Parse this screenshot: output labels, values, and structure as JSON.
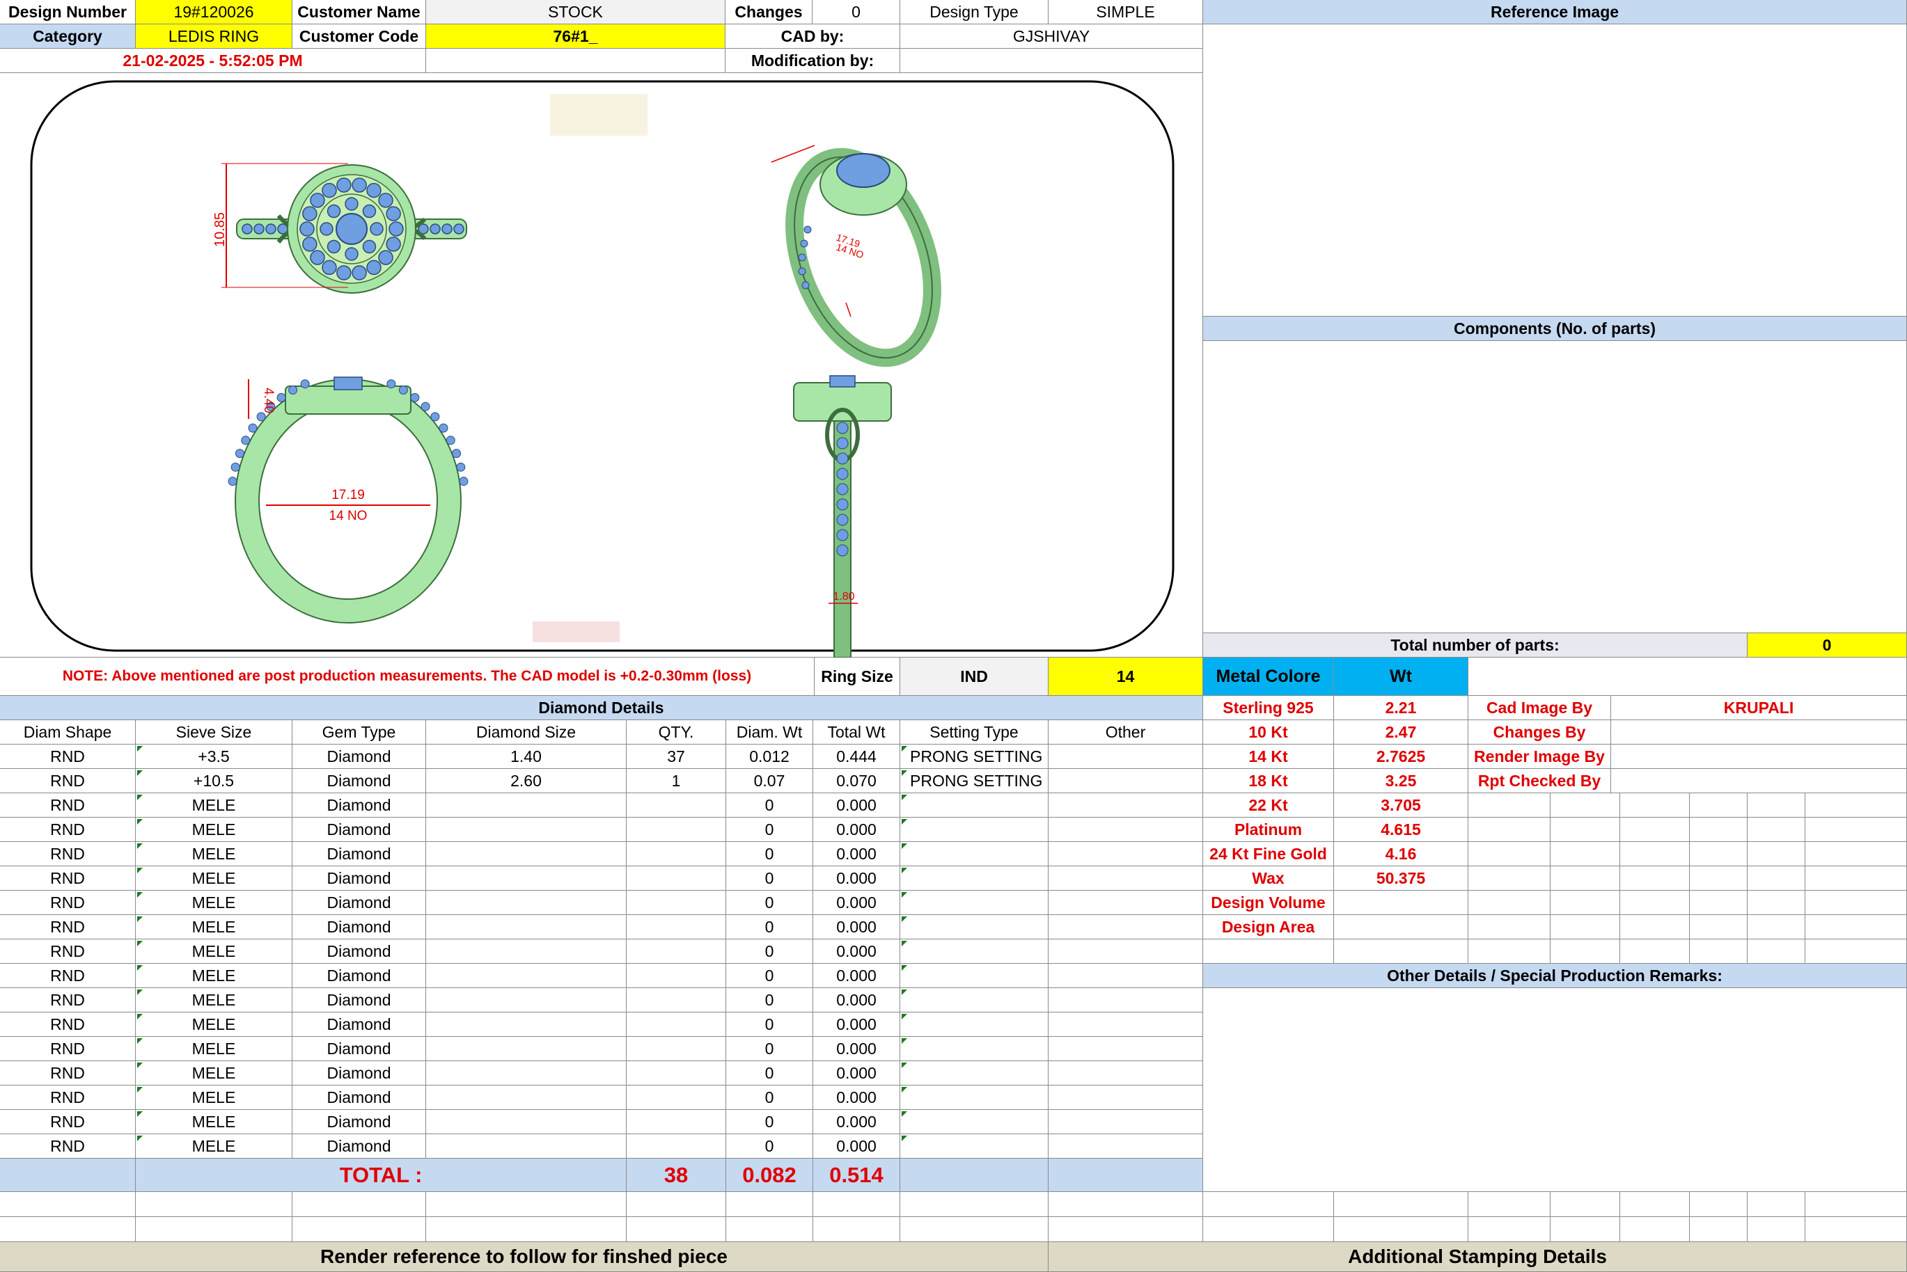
{
  "header": {
    "design_number_label": "Design Number",
    "design_number": "19#120026",
    "customer_name_label": "Customer Name",
    "customer_name": "STOCK",
    "changes_label": "Changes",
    "changes": "0",
    "design_type_label": "Design Type",
    "design_type": "SIMPLE",
    "reference_image_label": "Reference Image",
    "category_label": "Category",
    "category": "LEDIS RING",
    "customer_code_label": "Customer Code",
    "customer_code": "76#1_",
    "cad_by_label": "CAD by:",
    "cad_by": "GJSHIVAY",
    "datetime": "21-02-2025 - 5:52:05 PM",
    "modification_label": "Modification by:"
  },
  "cad": {
    "top_dim": "10.85",
    "side_dim1": "17.19",
    "side_dim2": "14 NO",
    "front_dim": "4.40",
    "inner_dim1": "17.19",
    "inner_dim2": "14 NO",
    "shank_dim": "1.80"
  },
  "components_label": "Components (No. of parts)",
  "total_parts_label": "Total number of parts:",
  "total_parts": "0",
  "note": "NOTE: Above mentioned are post production measurements. The CAD model is +0.2-0.30mm (loss)",
  "ring_size_label": "Ring Size",
  "ring_size_std": "IND",
  "ring_size": "14",
  "metal_colore_label": "Metal Colore",
  "wt_label": "Wt",
  "diamond_details_label": "Diamond Details",
  "diamond_headers": [
    "Diam Shape",
    "Sieve Size",
    "Gem Type",
    "Diamond Size",
    "QTY.",
    "Diam. Wt",
    "Total Wt",
    "Setting Type",
    "Other"
  ],
  "diamond_rows": [
    [
      "RND",
      "+3.5",
      "Diamond",
      "1.40",
      "37",
      "0.012",
      "0.444",
      "PRONG SETTING",
      ""
    ],
    [
      "RND",
      "+10.5",
      "Diamond",
      "2.60",
      "1",
      "0.07",
      "0.070",
      "PRONG SETTING",
      ""
    ],
    [
      "RND",
      "MELE",
      "Diamond",
      "",
      "",
      "0",
      "0.000",
      "",
      ""
    ],
    [
      "RND",
      "MELE",
      "Diamond",
      "",
      "",
      "0",
      "0.000",
      "",
      ""
    ],
    [
      "RND",
      "MELE",
      "Diamond",
      "",
      "",
      "0",
      "0.000",
      "",
      ""
    ],
    [
      "RND",
      "MELE",
      "Diamond",
      "",
      "",
      "0",
      "0.000",
      "",
      ""
    ],
    [
      "RND",
      "MELE",
      "Diamond",
      "",
      "",
      "0",
      "0.000",
      "",
      ""
    ],
    [
      "RND",
      "MELE",
      "Diamond",
      "",
      "",
      "0",
      "0.000",
      "",
      ""
    ],
    [
      "RND",
      "MELE",
      "Diamond",
      "",
      "",
      "0",
      "0.000",
      "",
      ""
    ],
    [
      "RND",
      "MELE",
      "Diamond",
      "",
      "",
      "0",
      "0.000",
      "",
      ""
    ],
    [
      "RND",
      "MELE",
      "Diamond",
      "",
      "",
      "0",
      "0.000",
      "",
      ""
    ],
    [
      "RND",
      "MELE",
      "Diamond",
      "",
      "",
      "0",
      "0.000",
      "",
      ""
    ],
    [
      "RND",
      "MELE",
      "Diamond",
      "",
      "",
      "0",
      "0.000",
      "",
      ""
    ],
    [
      "RND",
      "MELE",
      "Diamond",
      "",
      "",
      "0",
      "0.000",
      "",
      ""
    ],
    [
      "RND",
      "MELE",
      "Diamond",
      "",
      "",
      "0",
      "0.000",
      "",
      ""
    ],
    [
      "RND",
      "MELE",
      "Diamond",
      "",
      "",
      "0",
      "0.000",
      "",
      ""
    ],
    [
      "RND",
      "MELE",
      "Diamond",
      "",
      "",
      "0",
      "0.000",
      "",
      ""
    ]
  ],
  "total_label": "TOTAL :",
  "total_qty": "38",
  "total_diam_wt": "0.082",
  "total_wt": "0.514",
  "metals": [
    {
      "name": "Sterling 925",
      "wt": "2.21"
    },
    {
      "name": "10 Kt",
      "wt": "2.47"
    },
    {
      "name": "14 Kt",
      "wt": "2.7625"
    },
    {
      "name": "18 Kt",
      "wt": "3.25"
    },
    {
      "name": "22 Kt",
      "wt": "3.705"
    },
    {
      "name": "Platinum",
      "wt": "4.615"
    },
    {
      "name": "24 Kt Fine Gold",
      "wt": "4.16"
    },
    {
      "name": "Wax",
      "wt": "50.375"
    },
    {
      "name": "Design Volume",
      "wt": ""
    },
    {
      "name": "Design Area",
      "wt": ""
    }
  ],
  "credits": [
    {
      "label": "Cad Image By",
      "value": "KRUPALI"
    },
    {
      "label": "Changes By",
      "value": ""
    },
    {
      "label": "Render Image By",
      "value": ""
    },
    {
      "label": "Rpt Checked By",
      "value": ""
    }
  ],
  "other_details_label": "Other Details / Special Production Remarks:",
  "footer_left": "Render reference to follow for finshed piece",
  "footer_right": "Additional Stamping Details",
  "colors": {
    "yellow": "#ffff00",
    "light_blue": "#c5d9f1",
    "cyan": "#00b0f0",
    "red": "#e00000",
    "tan": "#ddd9c4",
    "ring_green": "#a8e6a8",
    "stone_blue": "#6f9fe0"
  }
}
